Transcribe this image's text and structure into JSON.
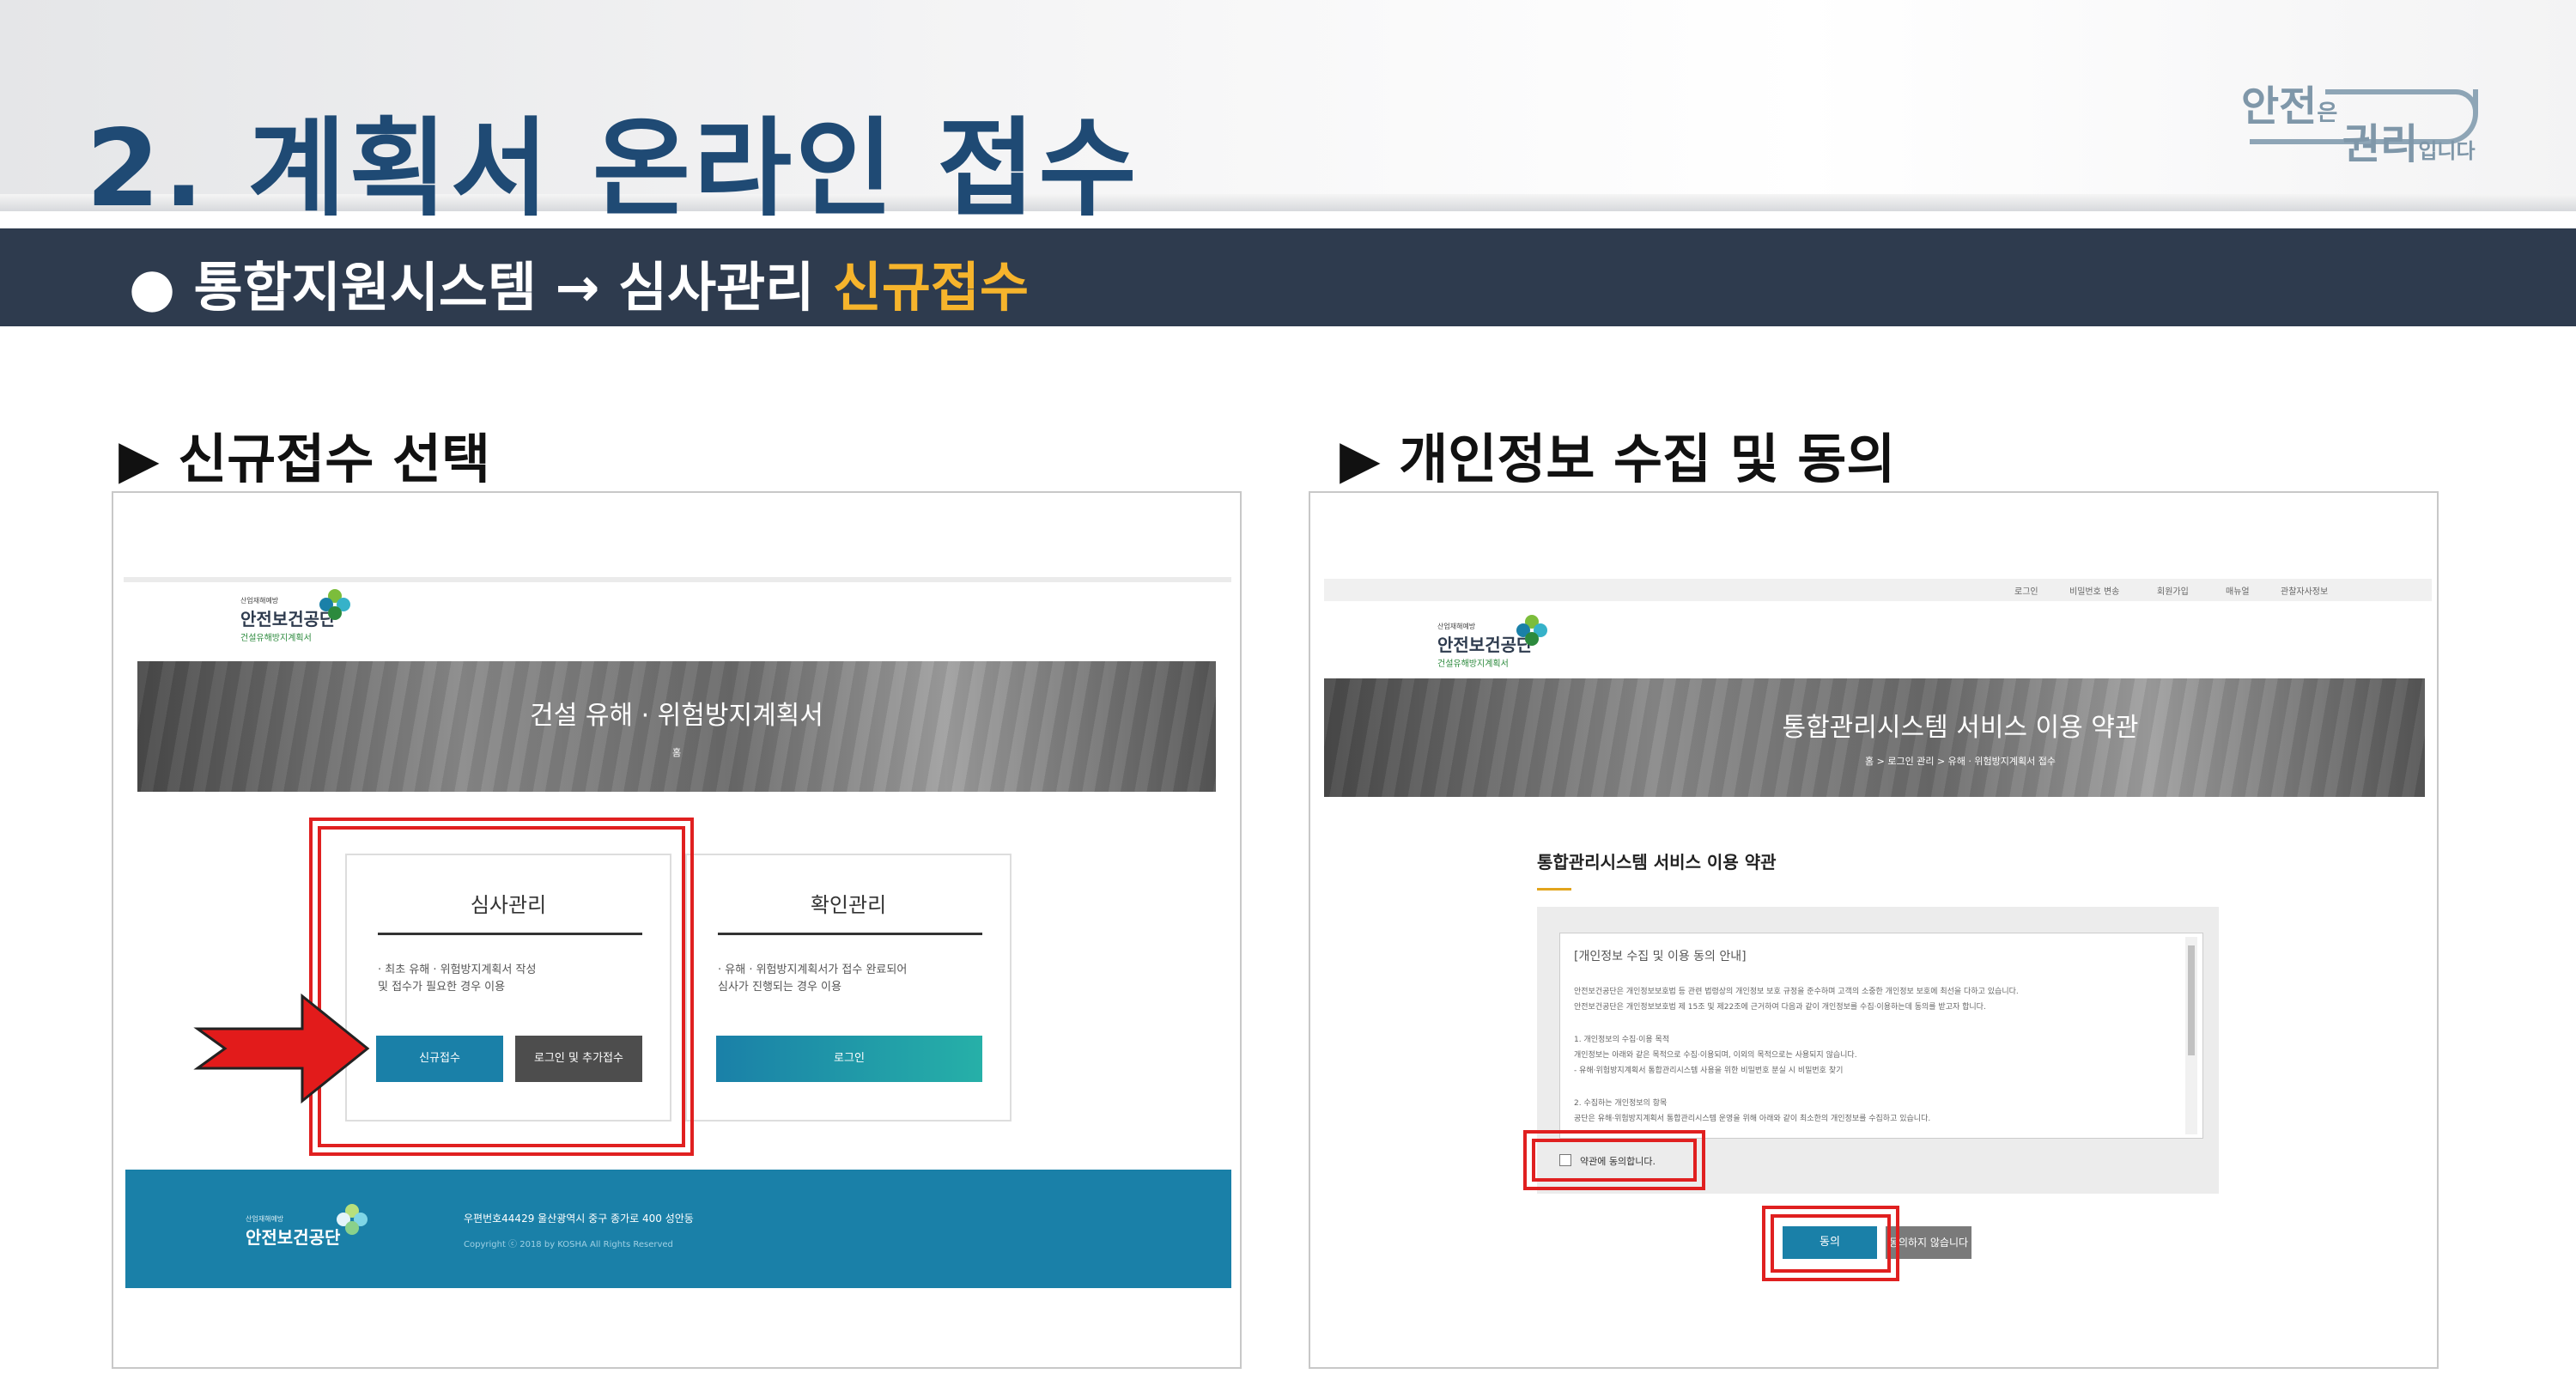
{
  "header": {
    "title": "2. 계획서 온라인 접수",
    "logo": {
      "line1": "안전",
      "line1_small": "은",
      "line2": "권리",
      "line2_small": "입니다"
    },
    "band_prefix": "● 통합지원시스템 → 심사관리 ",
    "band_highlight": "신규접수",
    "highlight_color": "#f6b42c"
  },
  "left": {
    "heading": "▶ 신규접수 선택",
    "org": {
      "small": "산업재해예방",
      "name": "안전보건공단",
      "sub": "건설유해방지계획서"
    },
    "banner_title": "건설 유해 · 위험방지계획서",
    "banner_sub": "홈",
    "card1": {
      "title": "심사관리",
      "desc1": "· 최초 유해 · 위험방지계획서 작성",
      "desc2": "  및 접수가 필요한 경우 이용",
      "btn_new": "신규접수",
      "btn_login_add": "로그인 및 추가접수"
    },
    "card2": {
      "title": "확인관리",
      "desc1": "· 유해 · 위험방지계획서가 접수 완료되어",
      "desc2": "  심사가 진행되는 경우 이용",
      "btn_login": "로그인"
    },
    "footer": {
      "org_small": "산업재해예방",
      "org_name": "안전보건공단",
      "address": "우편번호44429 울산광역시 중구 종가로 400 성안동",
      "copyright": "Copyright ⓒ 2018 by KOSHA All Rights Reserved"
    }
  },
  "right": {
    "heading": "▶ 개인정보 수집 및 동의",
    "topnav": [
      "로그인",
      "비밀번호 변송",
      "회원가입",
      "매뉴얼",
      "관찰자사정보"
    ],
    "org": {
      "small": "산업재해예방",
      "name": "안전보건공단",
      "sub": "건설유해방지계획서"
    },
    "banner_title": "통합관리시스템 서비스 이용 약관",
    "banner_sub": "홈 > 로그인 관리 > 유해 · 위험방지계획서 접수",
    "terms_title": "통합관리시스템 서비스 이용 약관",
    "terms_lines": [
      "[개인정보 수집 및 이용 동의 안내]",
      "안전보건공단은 개인정보보호법 등 관련 법령상의 개인정보 보호 규정을 준수하며 고객의 소중한 개인정보 보호에 최선을 다하고 있습니다.",
      "안전보건공단은 개인정보보호법 제 15조 및 제22조에 근거하여 다음과 같이 개인정보를 수집·이용하는데 동의를 받고자 합니다.",
      "1. 개인정보의 수집·이용 목적",
      "개인정보는 아래와 같은 목적으로 수집·이용되며, 이외의 목적으로는 사용되지 않습니다.",
      " - 유해·위험방지계획서 통합관리시스템 사용을 위한 비밀번호 분실 시 비밀번호 찾기",
      "2. 수집하는 개인정보의 항목",
      "공단은 유해·위험방지계획서 통합관리시스템 운영을 위해 아래와 같이 최소한의 개인정보를 수집하고 있습니다."
    ],
    "agree_label": "약관에 동의합니다.",
    "btn_agree": "동의",
    "btn_disagree": "동의하지 않습니다"
  }
}
